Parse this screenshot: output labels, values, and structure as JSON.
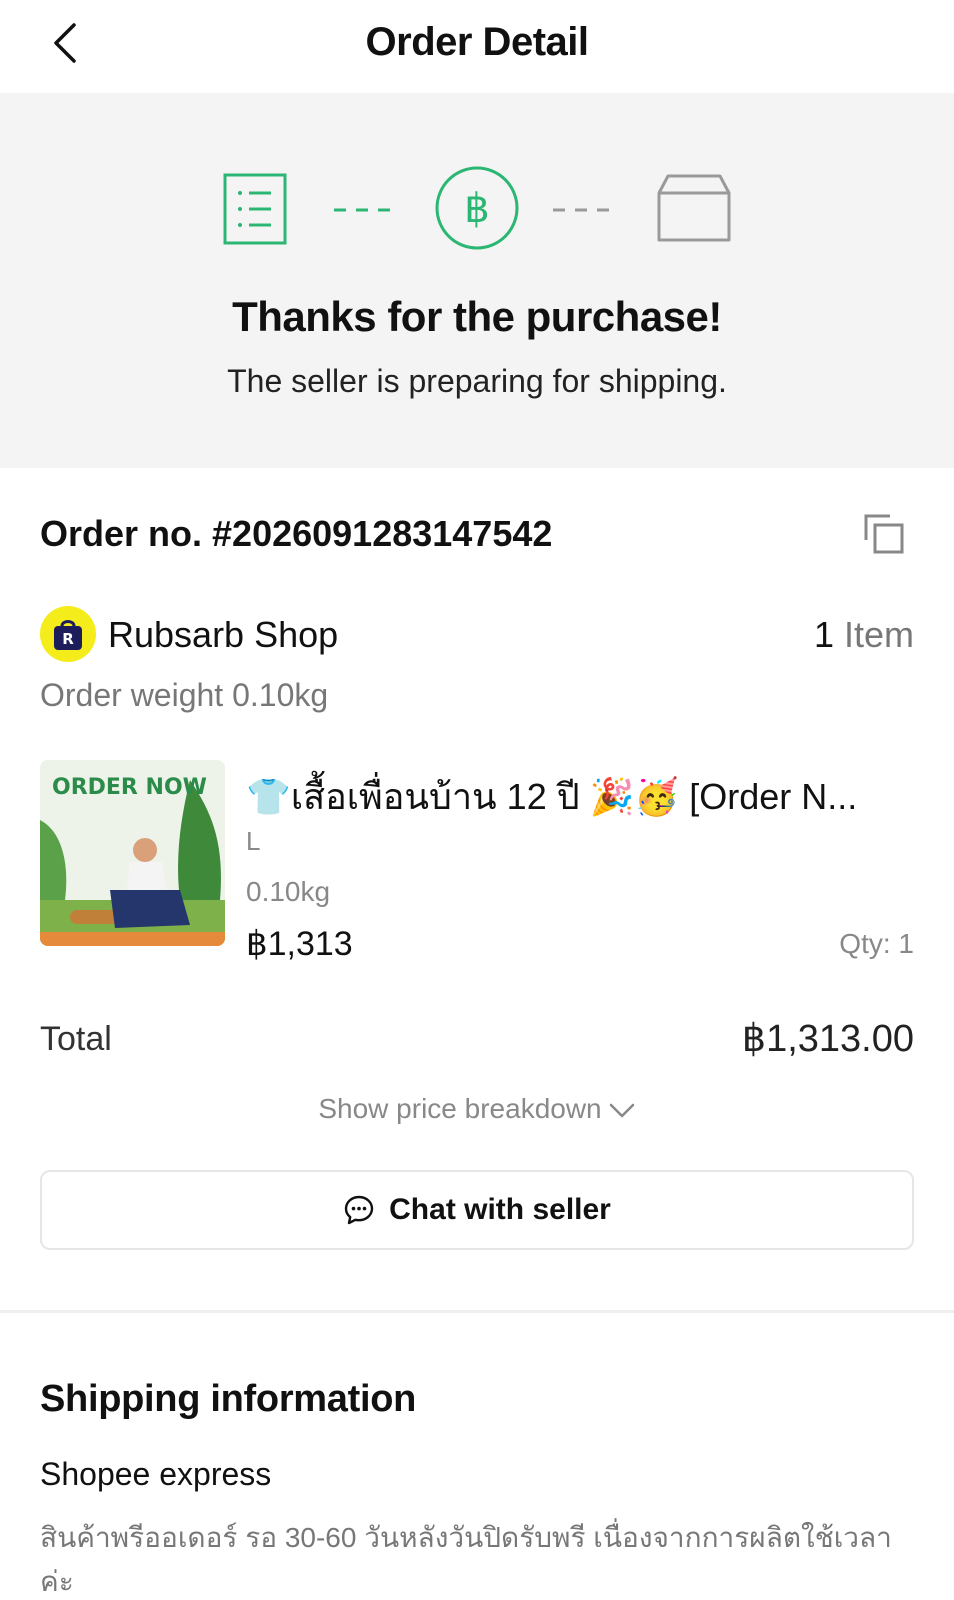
{
  "header": {
    "title": "Order Detail",
    "back_icon": "chevron-left-icon"
  },
  "status": {
    "steps": [
      {
        "icon": "order-list-icon",
        "state": "done"
      },
      {
        "icon": "baht-payment-icon",
        "state": "done"
      },
      {
        "icon": "package-box-icon",
        "state": "pending"
      }
    ],
    "title": "Thanks for the purchase!",
    "subtitle": "The seller is preparing for shipping."
  },
  "order": {
    "number": "Order no. #2026091283147542",
    "copy_icon": "copy-icon"
  },
  "shop": {
    "name": "Rubsarb Shop",
    "item_count": "1",
    "item_unit": "Item",
    "order_weight": "Order weight 0.10kg"
  },
  "product": {
    "title": "👕เสื้อเพื่อนบ้าน 12 ปี 🎉🥳 [Order N...",
    "variant": "L",
    "weight": "0.10kg",
    "price": "฿1,313",
    "qty": "Qty: 1",
    "thumb_text": "ORDER NOW"
  },
  "totals": {
    "label": "Total",
    "value": "฿1,313.00",
    "breakdown_label": "Show price breakdown"
  },
  "actions": {
    "chat_label": "Chat with seller"
  },
  "shipping": {
    "heading": "Shipping information",
    "carrier": "Shopee express",
    "note": "สินค้าพรีออเดอร์ รอ 30-60 วันหลังวันปิดรับพรี เนื่องจากการผลิตใช้เวลาค่ะ"
  },
  "colors": {
    "accent_green": "#2bb673",
    "pending_gray": "#9a9a9a",
    "panel_bg": "#f4f4f4",
    "shop_logo_bg": "#f5ec1c"
  }
}
